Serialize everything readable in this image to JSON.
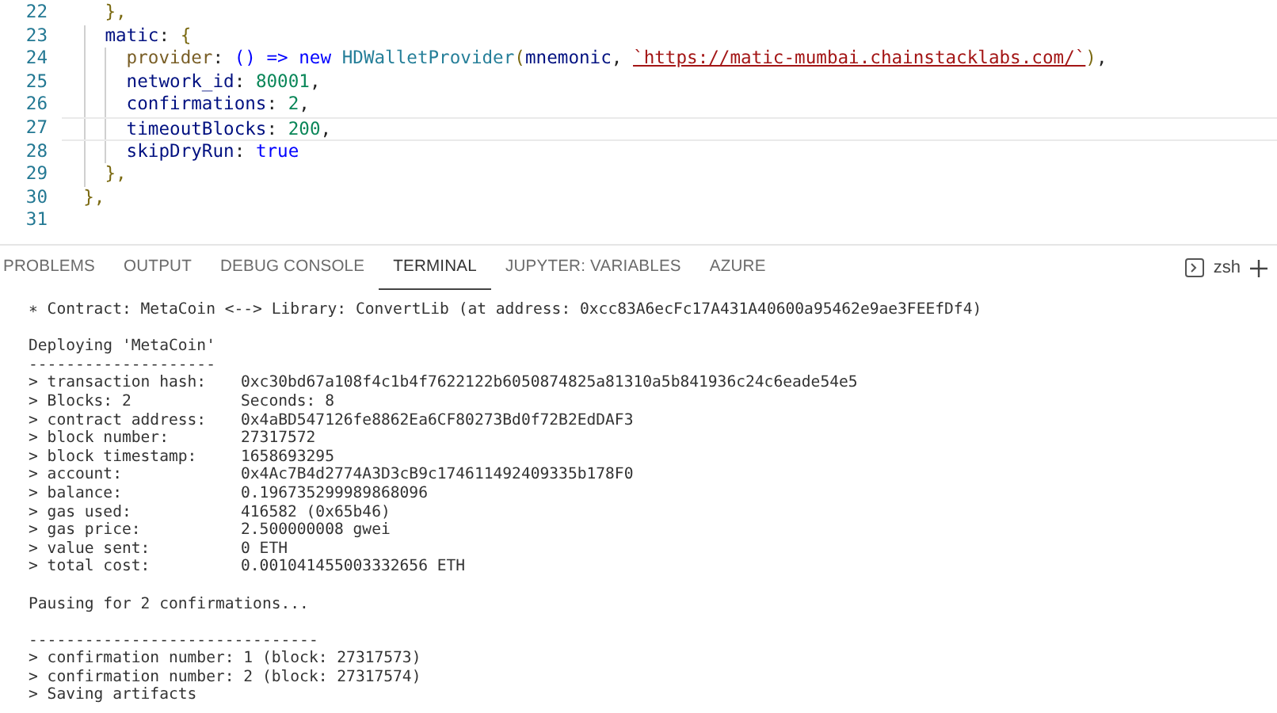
{
  "editor": {
    "lines": [
      {
        "number": "22",
        "current": false,
        "tokens": [
          {
            "kind": "punct",
            "text": "    },"
          }
        ]
      },
      {
        "number": "23",
        "current": false,
        "tokens": [
          {
            "kind": "prop",
            "text": "    matic"
          },
          {
            "kind": "plain",
            "text": ": "
          },
          {
            "kind": "punct",
            "text": "{"
          }
        ]
      },
      {
        "number": "24",
        "current": false,
        "tokens": [
          {
            "kind": "func",
            "text": "      provider"
          },
          {
            "kind": "plain",
            "text": ": "
          },
          {
            "kind": "keyword",
            "text": "() => new "
          },
          {
            "kind": "class",
            "text": "HDWalletProvider"
          },
          {
            "kind": "punct",
            "text": "("
          },
          {
            "kind": "prop",
            "text": "mnemonic"
          },
          {
            "kind": "plain",
            "text": ", "
          },
          {
            "kind": "string",
            "text": "`https://matic-mumbai.chainstacklabs.com/`"
          },
          {
            "kind": "punct",
            "text": ")"
          },
          {
            "kind": "plain",
            "text": ","
          }
        ]
      },
      {
        "number": "25",
        "current": false,
        "tokens": [
          {
            "kind": "prop",
            "text": "      network_id"
          },
          {
            "kind": "plain",
            "text": ": "
          },
          {
            "kind": "number",
            "text": "80001"
          },
          {
            "kind": "plain",
            "text": ","
          }
        ]
      },
      {
        "number": "26",
        "current": false,
        "tokens": [
          {
            "kind": "prop",
            "text": "      confirmations"
          },
          {
            "kind": "plain",
            "text": ": "
          },
          {
            "kind": "number",
            "text": "2"
          },
          {
            "kind": "plain",
            "text": ","
          }
        ]
      },
      {
        "number": "27",
        "current": true,
        "tokens": [
          {
            "kind": "prop",
            "text": "      timeoutBlocks"
          },
          {
            "kind": "plain",
            "text": ": "
          },
          {
            "kind": "number",
            "text": "200"
          },
          {
            "kind": "plain",
            "text": ","
          }
        ]
      },
      {
        "number": "28",
        "current": false,
        "tokens": [
          {
            "kind": "prop",
            "text": "      skipDryRun"
          },
          {
            "kind": "plain",
            "text": ": "
          },
          {
            "kind": "keyword",
            "text": "true"
          }
        ]
      },
      {
        "number": "29",
        "current": false,
        "tokens": [
          {
            "kind": "punct",
            "text": "    },"
          }
        ]
      },
      {
        "number": "30",
        "current": false,
        "tokens": [
          {
            "kind": "punct",
            "text": "  },"
          }
        ]
      },
      {
        "number": "31",
        "current": false
      }
    ]
  },
  "panel": {
    "tabs": [
      {
        "label": "PROBLEMS",
        "selected": false
      },
      {
        "label": "OUTPUT",
        "selected": false
      },
      {
        "label": "DEBUG CONSOLE",
        "selected": false
      },
      {
        "label": "TERMINAL",
        "selected": true
      },
      {
        "label": "JUPYTER: VARIABLES",
        "selected": false
      },
      {
        "label": "AZURE",
        "selected": false
      }
    ],
    "shell": "zsh"
  },
  "terminal": {
    "blocks": [
      {
        "lines": [
          {
            "kind": "text",
            "text": "∗ Contract: MetaCoin <--> Library: ConvertLib (at address: 0xcc83A6ecFc17A431A40600a95462e9ae3FEEfDf4)"
          }
        ]
      },
      {
        "lines": [
          {
            "kind": "text",
            "text": "Deploying 'MetaCoin'"
          },
          {
            "kind": "text",
            "text": "--------------------"
          },
          {
            "kind": "kv",
            "label": "> transaction hash:",
            "value": "0xc30bd67a108f4c1b4f7622122b6050874825a81310a5b841936c24c6eade54e5"
          },
          {
            "kind": "kv",
            "label": "> Blocks: 2",
            "value": "Seconds: 8"
          },
          {
            "kind": "kv",
            "label": "> contract address:",
            "value": "0x4aBD547126fe8862Ea6CF80273Bd0f72B2EdDAF3"
          },
          {
            "kind": "kv",
            "label": "> block number:",
            "value": "27317572"
          },
          {
            "kind": "kv",
            "label": "> block timestamp:",
            "value": "1658693295"
          },
          {
            "kind": "kv",
            "label": "> account:",
            "value": "0x4Ac7B4d2774A3D3cB9c174611492409335b178F0"
          },
          {
            "kind": "kv",
            "label": "> balance:",
            "value": "0.196735299989868096"
          },
          {
            "kind": "kv",
            "label": "> gas used:",
            "value": "416582 (0x65b46)"
          },
          {
            "kind": "kv",
            "label": "> gas price:",
            "value": "2.500000008 gwei"
          },
          {
            "kind": "kv",
            "label": "> value sent:",
            "value": "0 ETH"
          },
          {
            "kind": "kv",
            "label": "> total cost:",
            "value": "0.001041455003332656 ETH"
          }
        ]
      },
      {
        "lines": [
          {
            "kind": "text",
            "text": "Pausing for 2 confirmations..."
          }
        ]
      },
      {
        "lines": [
          {
            "kind": "text",
            "text": "-------------------------------"
          },
          {
            "kind": "text",
            "text": "> confirmation number: 1 (block: 27317573)"
          },
          {
            "kind": "text",
            "text": "> confirmation number: 2 (block: 27317574)"
          },
          {
            "kind": "text",
            "text": "> Saving artifacts"
          }
        ]
      }
    ]
  }
}
